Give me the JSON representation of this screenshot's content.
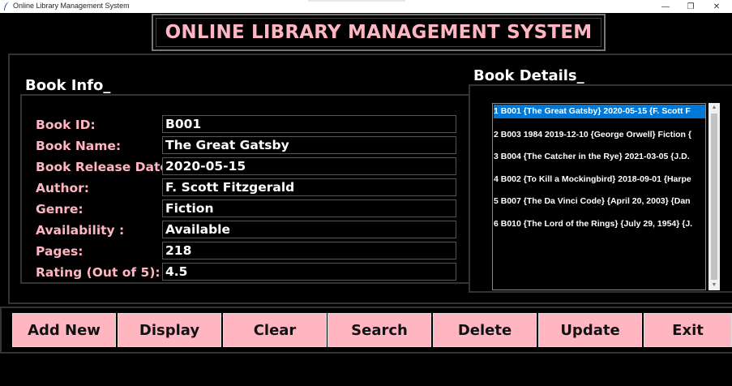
{
  "window": {
    "title": "Online Library Management System",
    "controls": {
      "minimize": "—",
      "restore": "❐",
      "close": "✕"
    }
  },
  "banner": {
    "title": "ONLINE LIBRARY MANAGEMENT SYSTEM"
  },
  "book_info": {
    "heading": "Book Info_",
    "fields": [
      {
        "label": "Book ID:",
        "value": "B001"
      },
      {
        "label": "Book Name:",
        "value": "The Great Gatsby"
      },
      {
        "label": "Book Release Date:",
        "value": "2020-05-15"
      },
      {
        "label": "Author:",
        "value": "F. Scott Fitzgerald"
      },
      {
        "label": "Genre:",
        "value": "Fiction"
      },
      {
        "label": "Availability :",
        "value": "Available"
      },
      {
        "label": "Pages:",
        "value": "218"
      },
      {
        "label": "Rating (Out of 5):",
        "value": "4.5"
      }
    ]
  },
  "book_details": {
    "heading": "Book Details_",
    "items": [
      "1 B001 {The Great Gatsby} 2020-05-15 {F. Scott F",
      "2 B003 1984 2019-12-10 {George Orwell} Fiction {",
      "3 B004 {The Catcher in the Rye} 2021-03-05 {J.D.",
      "4 B002 {To Kill a Mockingbird} 2018-09-01 {Harpe",
      "5 B007 {The Da Vinci Code} {April 20, 2003} {Dan",
      "6 B010 {The Lord of the Rings} {July 29, 1954} {J."
    ],
    "selected_index": 0
  },
  "buttons": {
    "add_new": "Add New",
    "display": "Display",
    "clear": "Clear",
    "search": "Search",
    "delete": "Delete",
    "update": "Update",
    "exit": "Exit"
  },
  "colors": {
    "accent": "#ffb6c1",
    "selection": "#0078d7",
    "background": "#000000"
  }
}
